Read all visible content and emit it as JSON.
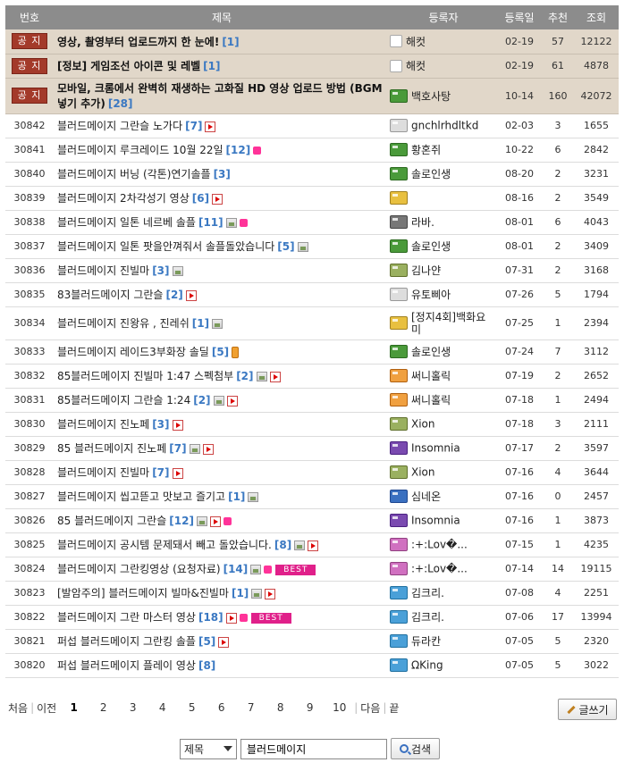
{
  "headers": {
    "no": "번호",
    "title": "제목",
    "author": "등록자",
    "date": "등록일",
    "rec": "추천",
    "views": "조회"
  },
  "notice_label": "공 지",
  "notices": [
    {
      "title": "영상, 촬영부터 업로드까지 한 눈에!",
      "comments": "[1]",
      "user": "해컷",
      "level_icon": "admin-icon",
      "date": "02-19",
      "rec": "57",
      "views": "12122"
    },
    {
      "title": "[정보] 게임조선 아이콘 및 레벨",
      "comments": "[1]",
      "user": "해컷",
      "level_icon": "admin-icon",
      "date": "02-19",
      "rec": "61",
      "views": "4878"
    },
    {
      "title": "모바일, 크롬에서 완벽히 재생하는 고화질 HD 영상 업로드 방법 (BGM넣기 추가)",
      "comments": "[28]",
      "user": "백호사탕",
      "level_icon": "green",
      "date": "10-14",
      "rec": "160",
      "views": "42072"
    }
  ],
  "posts": [
    {
      "no": "30842",
      "title": "블러드메이지 그란슬 노가다",
      "comments": "[7]",
      "icons": [
        "play"
      ],
      "user": "gnchlrhdltkd",
      "lv": "gray",
      "date": "02-03",
      "rec": "3",
      "views": "1655"
    },
    {
      "no": "30841",
      "title": "블러드메이지 루크레이드 10월 22일",
      "comments": "[12]",
      "icons": [
        "h"
      ],
      "user": "황혼쥐",
      "lv": "green",
      "date": "10-22",
      "rec": "6",
      "views": "2842"
    },
    {
      "no": "30840",
      "title": "블러드메이지 버닝 (각톤)연기솔플",
      "comments": "[3]",
      "icons": [],
      "user": "솔로인생",
      "lv": "green",
      "date": "08-20",
      "rec": "2",
      "views": "3231"
    },
    {
      "no": "30839",
      "title": "블러드메이지 2차각성기 영상",
      "comments": "[6]",
      "icons": [
        "play"
      ],
      "user": "",
      "lv": "yellow",
      "date": "08-16",
      "rec": "2",
      "views": "3549"
    },
    {
      "no": "30838",
      "title": "블러드메이지 일톤 네르베 솔플",
      "comments": "[11]",
      "icons": [
        "img",
        "h"
      ],
      "user": "라바.",
      "lv": "dark",
      "date": "08-01",
      "rec": "6",
      "views": "4043"
    },
    {
      "no": "30837",
      "title": "블러드메이지 일톤 팟을안껴줘서 솔플돌았습니다",
      "comments": "[5]",
      "icons": [
        "img"
      ],
      "user": "솔로인생",
      "lv": "green",
      "date": "08-01",
      "rec": "2",
      "views": "3409"
    },
    {
      "no": "30836",
      "title": "블러드메이지 진빌마",
      "comments": "[3]",
      "icons": [
        "img"
      ],
      "user": "김나얀",
      "lv": "olive",
      "date": "07-31",
      "rec": "2",
      "views": "3168"
    },
    {
      "no": "30835",
      "title": "83블러드메이지 그란슬",
      "comments": "[2]",
      "icons": [
        "play"
      ],
      "user": "유토삐아",
      "lv": "gray",
      "date": "07-26",
      "rec": "5",
      "views": "1794"
    },
    {
      "no": "30834",
      "title": "블러드메이지 진왕유 , 진레쉬",
      "comments": "[1]",
      "icons": [
        "img"
      ],
      "user": "[정지4회]백화요미",
      "lv": "yellow",
      "date": "07-25",
      "rec": "1",
      "views": "2394",
      "tall": true
    },
    {
      "no": "30833",
      "title": "블러드메이지 레이드3부화장 솔딜",
      "comments": "[5]",
      "icons": [
        "phone"
      ],
      "user": "솔로인생",
      "lv": "green",
      "date": "07-24",
      "rec": "7",
      "views": "3112"
    },
    {
      "no": "30832",
      "title": "85블러드메이지 진빌마 1:47 스펙첨부",
      "comments": "[2]",
      "icons": [
        "img",
        "play"
      ],
      "user": "써니홀릭",
      "lv": "orange",
      "date": "07-19",
      "rec": "2",
      "views": "2652"
    },
    {
      "no": "30831",
      "title": "85블러드메이지 그란슬 1:24",
      "comments": "[2]",
      "icons": [
        "img",
        "play"
      ],
      "user": "써니홀릭",
      "lv": "orange",
      "date": "07-18",
      "rec": "1",
      "views": "2494"
    },
    {
      "no": "30830",
      "title": "블러드메이지 진노페",
      "comments": "[3]",
      "icons": [
        "play"
      ],
      "user": "Xion",
      "lv": "olive",
      "date": "07-18",
      "rec": "3",
      "views": "2111"
    },
    {
      "no": "30829",
      "title": "85 블러드메이지 진노페",
      "comments": "[7]",
      "icons": [
        "img",
        "play"
      ],
      "user": "Insomnia",
      "lv": "purple",
      "date": "07-17",
      "rec": "2",
      "views": "3597"
    },
    {
      "no": "30828",
      "title": "블러드메이지 진빌마",
      "comments": "[7]",
      "icons": [
        "play"
      ],
      "user": "Xion",
      "lv": "olive",
      "date": "07-16",
      "rec": "4",
      "views": "3644"
    },
    {
      "no": "30827",
      "title": "블러드메이지 씹고뜯고 맛보고 즐기고",
      "comments": "[1]",
      "icons": [
        "img"
      ],
      "user": "심네온",
      "lv": "blue",
      "date": "07-16",
      "rec": "0",
      "views": "2457"
    },
    {
      "no": "30826",
      "title": "85 블러드메이지 그란슬",
      "comments": "[12]",
      "icons": [
        "img",
        "play",
        "h"
      ],
      "user": "Insomnia",
      "lv": "purple",
      "date": "07-16",
      "rec": "1",
      "views": "3873"
    },
    {
      "no": "30825",
      "title": "블러드메이지 공시템 문제돼서 빼고 돌았습니다.",
      "comments": "[8]",
      "icons": [
        "img",
        "play"
      ],
      "user": ":+:Lov�...",
      "lv": "pink",
      "date": "07-15",
      "rec": "1",
      "views": "4235"
    },
    {
      "no": "30824",
      "title": "블러드메이지 그란킹영상 (요청자료)",
      "comments": "[14]",
      "icons": [
        "img",
        "h"
      ],
      "best": true,
      "user": ":+:Lov�...",
      "lv": "pink",
      "date": "07-14",
      "rec": "14",
      "views": "19115"
    },
    {
      "no": "30823",
      "title": "[발암주의] 블러드메이지 빌마&진빌마",
      "comments": "[1]",
      "icons": [
        "img",
        "play"
      ],
      "user": "김크리.",
      "lv": "sky",
      "date": "07-08",
      "rec": "4",
      "views": "2251"
    },
    {
      "no": "30822",
      "title": "블러드메이지 그란 마스터 영상",
      "comments": "[18]",
      "icons": [
        "play",
        "h"
      ],
      "best": true,
      "user": "김크리.",
      "lv": "sky",
      "date": "07-06",
      "rec": "17",
      "views": "13994"
    },
    {
      "no": "30821",
      "title": "퍼섭 블러드메이지 그란킹 솔플",
      "comments": "[5]",
      "icons": [
        "play"
      ],
      "user": "듀라칸",
      "lv": "sky",
      "date": "07-05",
      "rec": "5",
      "views": "2320"
    },
    {
      "no": "30820",
      "title": "퍼섭 블러드메이지 플레이 영상",
      "comments": "[8]",
      "icons": [],
      "user": "ΩKing",
      "lv": "sky",
      "date": "07-05",
      "rec": "5",
      "views": "3022"
    }
  ],
  "best_label": "BEST",
  "pager": {
    "first": "처음",
    "prev": "이전",
    "pages": [
      "1",
      "2",
      "3",
      "4",
      "5",
      "6",
      "7",
      "8",
      "9",
      "10"
    ],
    "current": "1",
    "next": "다음",
    "last": "끝"
  },
  "write_label": "글쓰기",
  "search": {
    "field": "제목",
    "query": "블러드메이지",
    "button": "검색"
  }
}
